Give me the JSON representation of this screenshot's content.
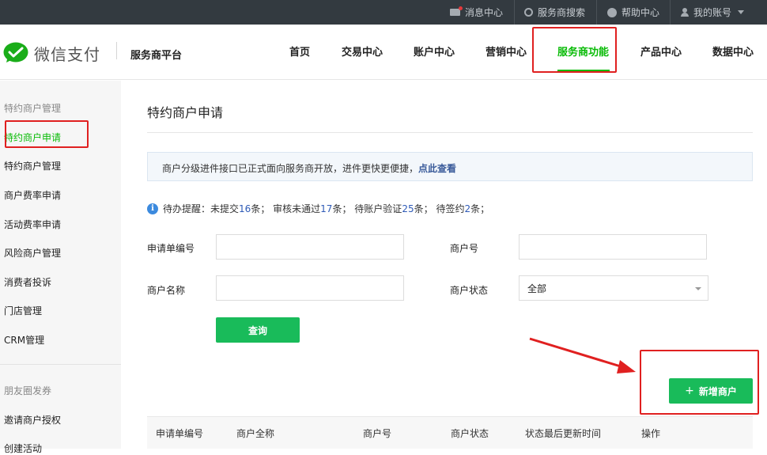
{
  "topbar": {
    "messages": "消息中心",
    "provider_search": "服务商搜索",
    "help": "帮助中心",
    "account": "我的账号"
  },
  "header": {
    "brand": "微信支付",
    "platform": "服务商平台",
    "nav": [
      "首页",
      "交易中心",
      "账户中心",
      "营销中心",
      "服务商功能",
      "产品中心",
      "数据中心"
    ],
    "active_nav": "服务商功能"
  },
  "sidebar": {
    "group1": "特约商户管理",
    "items1": [
      "特约商户申请",
      "特约商户管理",
      "商户费率申请",
      "活动费率申请",
      "风险商户管理",
      "消费者投诉",
      "门店管理",
      "CRM管理"
    ],
    "group2": "朋友圈发券",
    "items2": [
      "邀请商户授权",
      "创建活动"
    ]
  },
  "main": {
    "title": "特约商户申请",
    "notice_text": "商户分级进件接口已正式面向服务商开放，进件更快更便捷，",
    "notice_link": "点此查看",
    "todo": {
      "prefix": "待办提醒：",
      "unsubmitted_label": "未提交",
      "unsubmitted_count": "16",
      "rejected_label": "审核未通过",
      "rejected_count": "17",
      "verify_label": "待账户验证",
      "verify_count": "25",
      "sign_label": "待签约",
      "sign_count": "2",
      "unit": "条"
    },
    "form": {
      "app_no_label": "申请单编号",
      "app_no_value": "",
      "merchant_no_label": "商户号",
      "merchant_no_value": "",
      "merchant_name_label": "商户名称",
      "merchant_name_value": "",
      "status_label": "商户状态",
      "status_value": "全部"
    },
    "query_button": "查询",
    "add_button": "新增商户",
    "table_headers": [
      "申请单编号",
      "商户全称",
      "商户号",
      "商户状态",
      "状态最后更新时间",
      "操作"
    ]
  },
  "colors": {
    "accent_green": "#09bb07",
    "button_green": "#19bb5a",
    "highlight_red": "#e02020",
    "link_blue": "#2f5bb7",
    "topbar_bg": "#333a40"
  }
}
